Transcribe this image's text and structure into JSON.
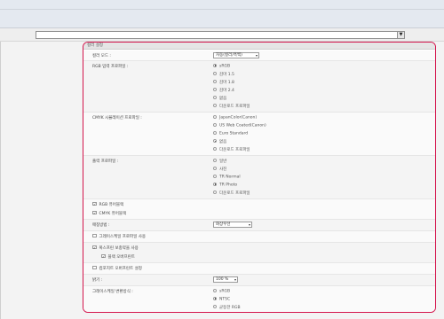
{
  "panel": {
    "title": "컬러 설정"
  },
  "color_mode": {
    "label": "컬러 모드 :",
    "value": "자동(컬러/흑백)"
  },
  "rgb_profile": {
    "label": "RGB 입력 프로파일 :",
    "options": [
      "sRGB",
      "감마 1.5",
      "감마 1.8",
      "감마 2.4",
      "없음",
      "다운로드 프로파일"
    ],
    "selected": 0
  },
  "cmyk_profile": {
    "label": "CMYK 시뮬레이션 프로파일 :",
    "options": [
      "JapanColor(Canon)",
      "US Web Coated(Canon)",
      "Euro Standard",
      "없음",
      "다운로드 프로파일"
    ],
    "selected": 3
  },
  "output_profile": {
    "label": "출력 프로파일 :",
    "options": [
      "일반",
      "사진",
      "TR Normal",
      "TR Photo",
      "다운로드 프로파일"
    ],
    "selected": 3
  },
  "checks": {
    "rgb_pure_black": {
      "label": "RGB 퓨어블랙",
      "checked": true
    },
    "cmyk_pure_black": {
      "label": "CMYK 퓨어블랙",
      "checked": true
    }
  },
  "matching_method": {
    "label": "매칭방법 :",
    "value": "화상우선"
  },
  "grayscale_profile": {
    "label": "그레이스케일 프로파일 사용",
    "checked": false
  },
  "composite_overprint": {
    "label": "복스프린 보충약을 사용",
    "checked": true
  },
  "separate_color_k": {
    "label": "블랙 오버프린트",
    "checked": true
  },
  "brightness_adjust": {
    "label": "컴포지트 오버프린트 설정",
    "checked": false
  },
  "brightness": {
    "label": "밝기 :",
    "value": "100 %"
  },
  "grayscale_convert": {
    "label": "그레이스케일 변환방식 :",
    "options": [
      "sRGB",
      "NTSC",
      "균등한 RGB"
    ],
    "selected": 1
  }
}
